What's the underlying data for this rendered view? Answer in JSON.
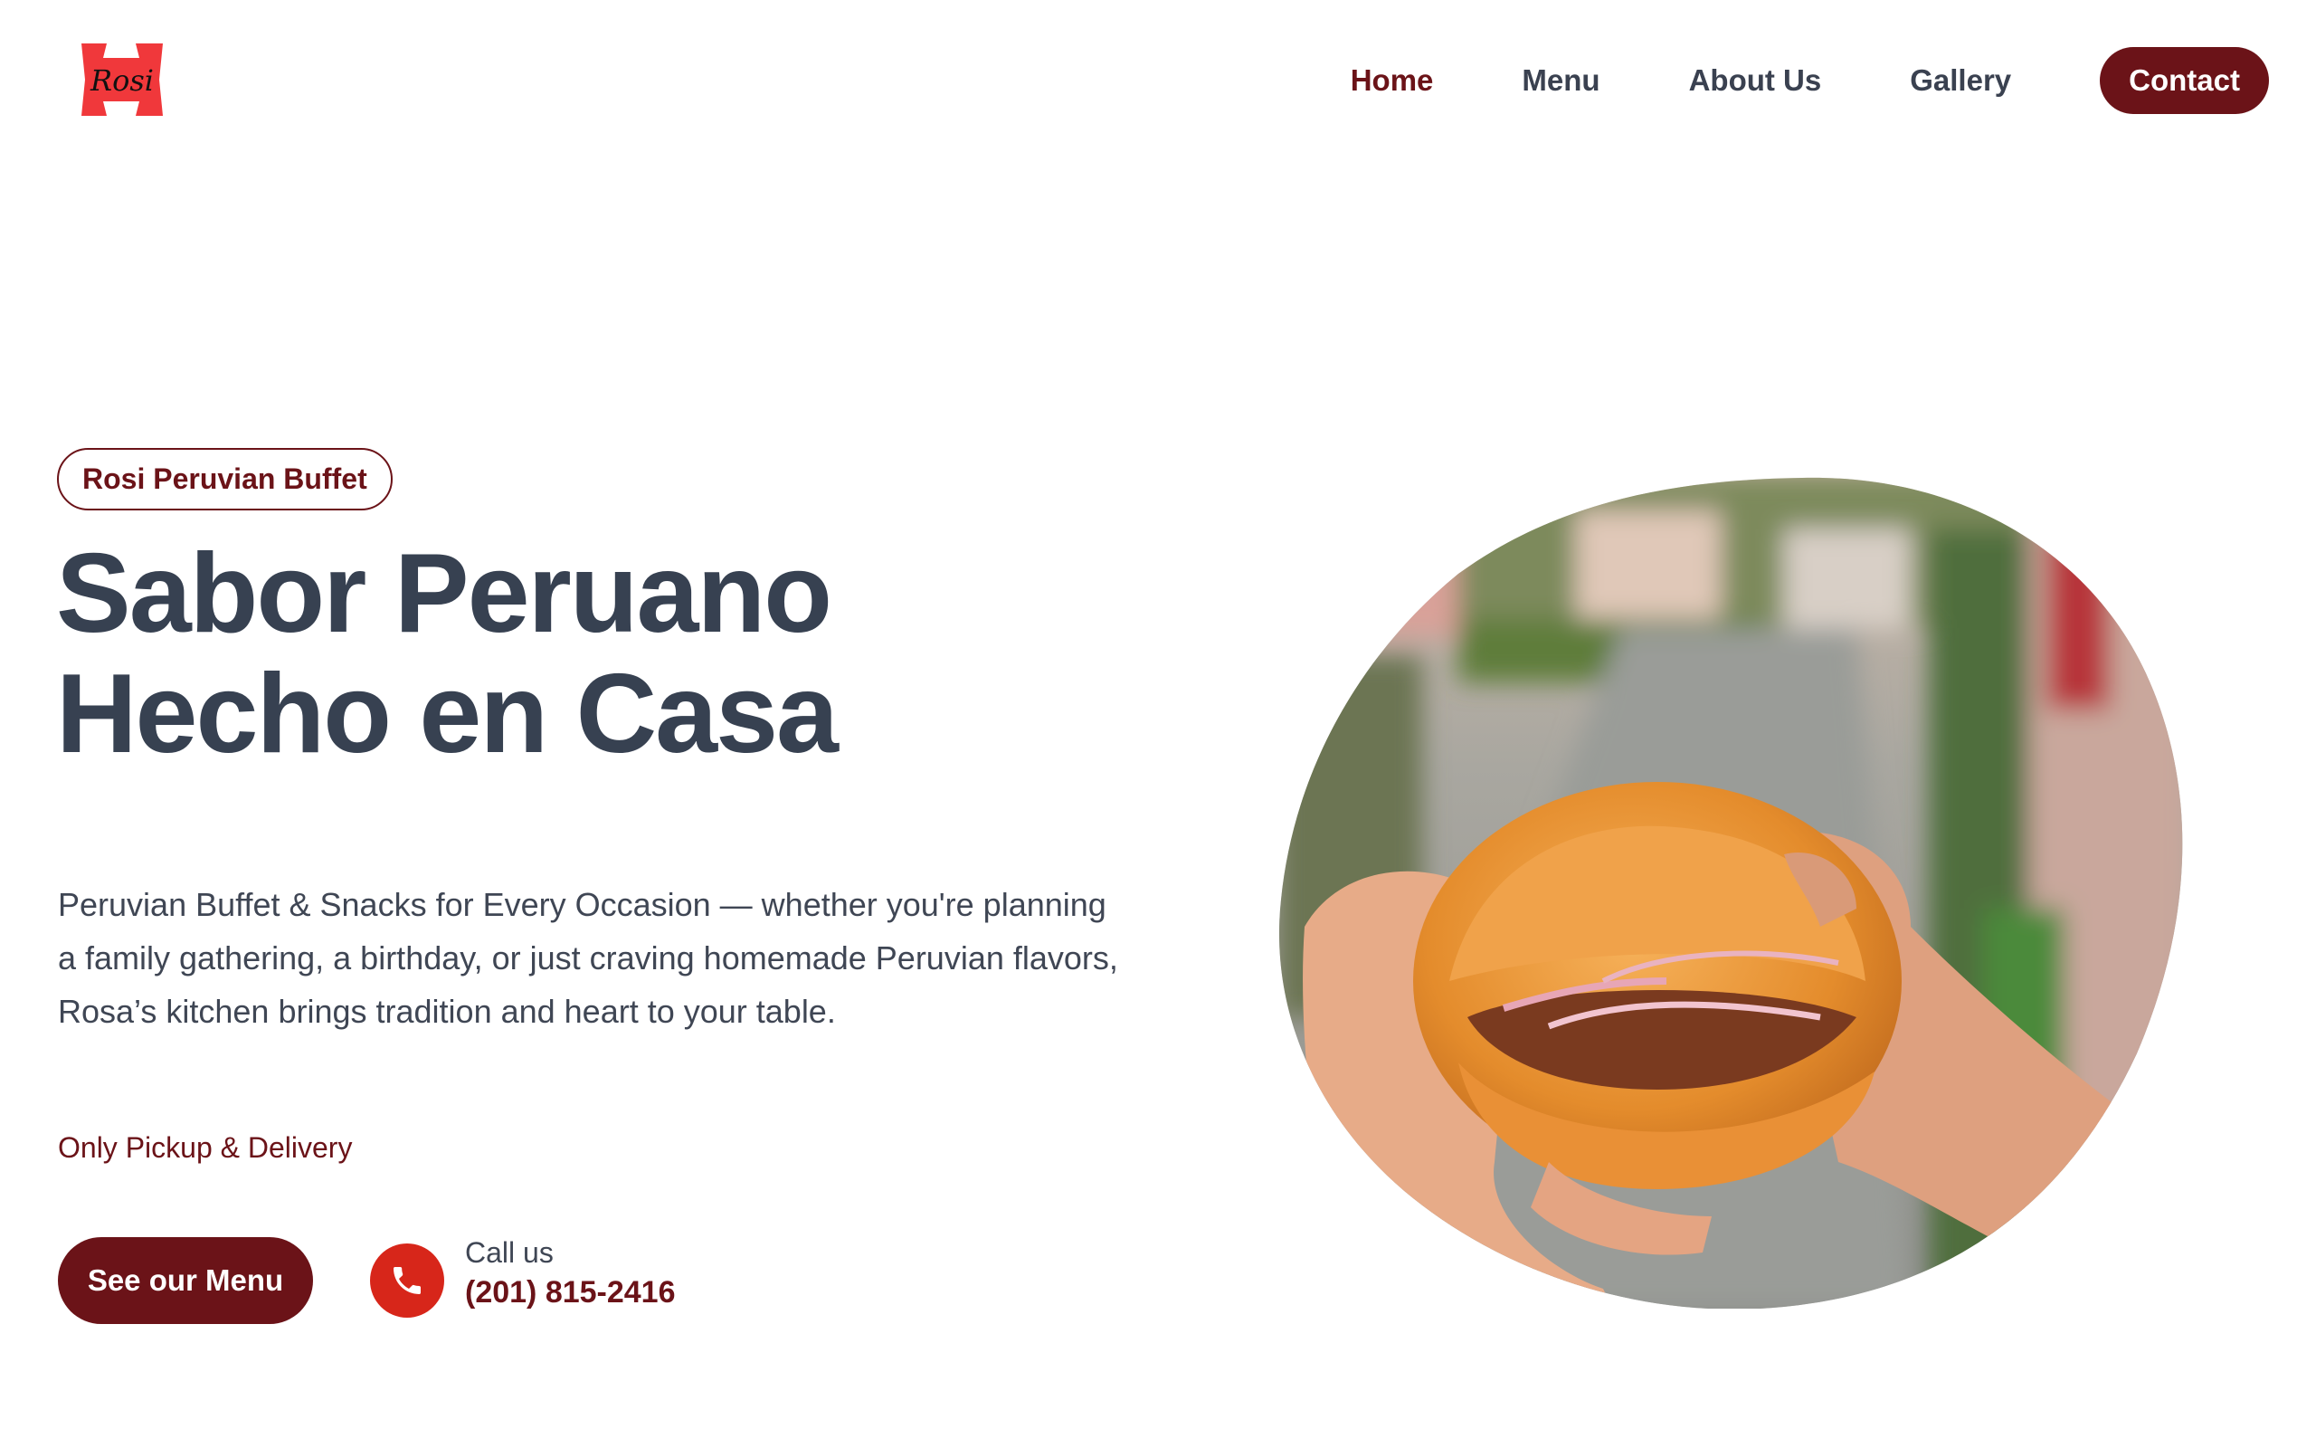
{
  "header": {
    "logo_text": "Rosi",
    "nav": [
      {
        "label": "Home",
        "active": true
      },
      {
        "label": "Menu",
        "active": false
      },
      {
        "label": "About Us",
        "active": false
      },
      {
        "label": "Gallery",
        "active": false
      }
    ],
    "contact_label": "Contact"
  },
  "hero": {
    "badge": "Rosi Peruvian Buffet",
    "title_line1": "Sabor Peruano",
    "title_line2": "Hecho en Casa",
    "description": "Peruvian Buffet & Snacks for Every Occasion — whether you're planning a family gathering, a birthday, or just craving homemade Peruvian flavors, Rosa’s kitchen brings tradition and heart to your table.",
    "pickup_note": "Only Pickup & Delivery",
    "menu_button": "See our Menu",
    "call_label": "Call us",
    "phone": "(201) 815-2416",
    "image_icon": "sandwich-photo"
  },
  "colors": {
    "brand": "#6b1318",
    "phone_icon_bg": "#d7261a",
    "heading": "#374151",
    "logo_red": "#f0383b"
  }
}
